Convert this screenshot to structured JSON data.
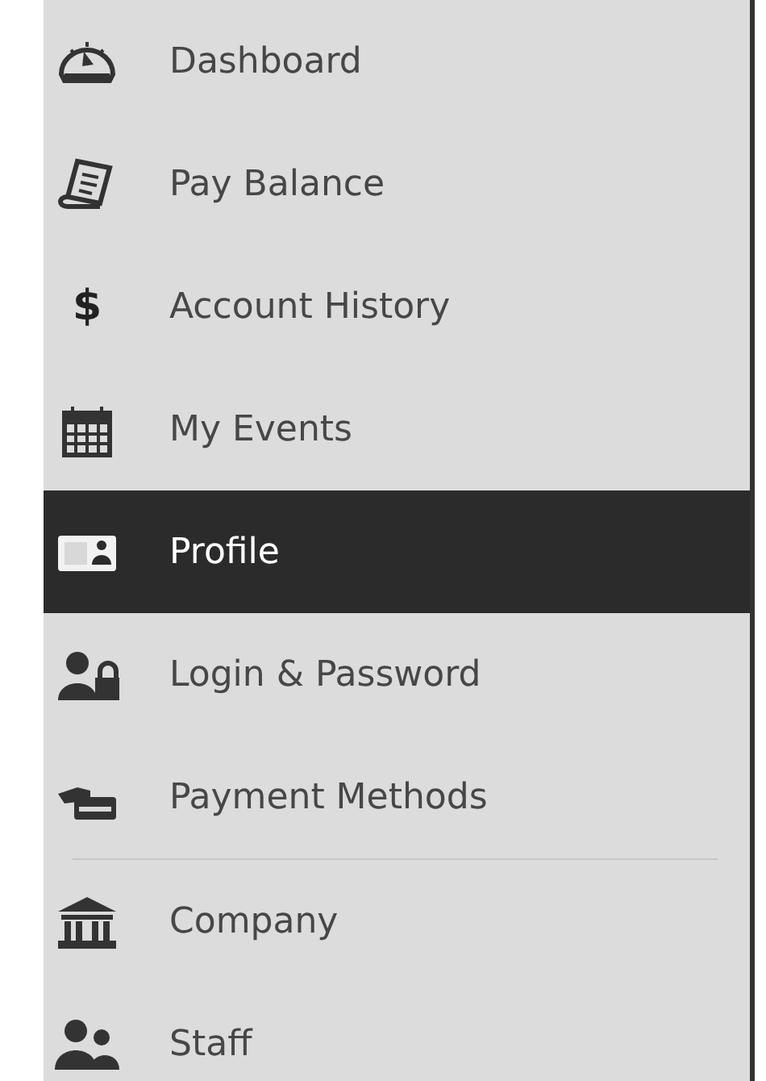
{
  "menu": {
    "groups": [
      {
        "items": [
          {
            "label": "Dashboard",
            "selected": false
          },
          {
            "label": "Pay Balance",
            "selected": false
          },
          {
            "label": "$",
            "kind": "glyph",
            "label2": "Account History",
            "selected": false
          },
          {
            "label": "My Events",
            "selected": false
          },
          {
            "label": "Profile",
            "selected": true
          },
          {
            "label": "Login & Password",
            "selected": false
          },
          {
            "label": "Payment Methods",
            "selected": false
          }
        ]
      },
      {
        "items": [
          {
            "label": "Company",
            "selected": false
          },
          {
            "label": "Staff",
            "selected": false
          }
        ]
      }
    ]
  }
}
